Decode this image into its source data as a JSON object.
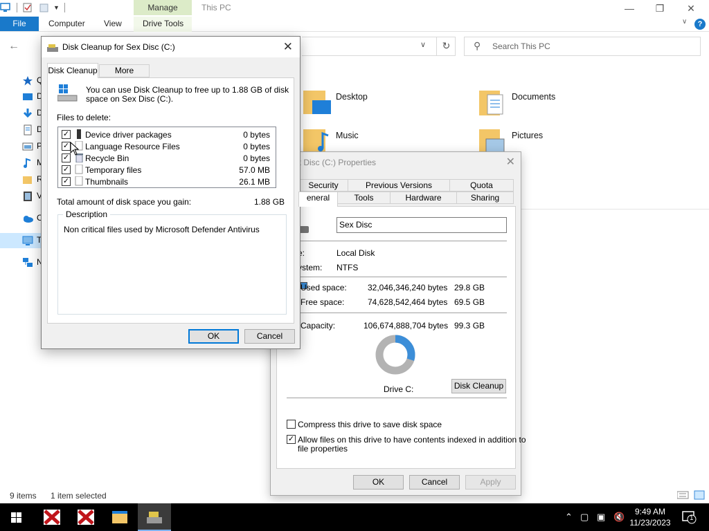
{
  "explorer": {
    "title": "This PC",
    "ribbon_context_tab": "Manage",
    "tabs": {
      "file": "File",
      "computer": "Computer",
      "view": "View",
      "drive_tools": "Drive Tools"
    },
    "search_placeholder": "Search This PC",
    "sidebar": [
      {
        "label": "Qu",
        "icon": "star-icon"
      },
      {
        "label": "D",
        "icon": "desktop-icon"
      },
      {
        "label": "D",
        "icon": "downloads-icon"
      },
      {
        "label": "D",
        "icon": "documents-icon"
      },
      {
        "label": "P",
        "icon": "pictures-icon"
      },
      {
        "label": "M",
        "icon": "music-icon"
      },
      {
        "label": "R",
        "icon": "folder-icon"
      },
      {
        "label": "V",
        "icon": "videos-icon"
      },
      {
        "label": "On",
        "icon": "onedrive-icon"
      },
      {
        "label": "Thi",
        "icon": "this-pc-icon"
      },
      {
        "label": "Ne",
        "icon": "network-icon"
      }
    ],
    "folders": [
      {
        "label": "Desktop"
      },
      {
        "label": "Documents"
      },
      {
        "label": "Music"
      },
      {
        "label": "Pictures"
      }
    ],
    "status": {
      "items": "9 items",
      "selected": "1 item selected"
    }
  },
  "properties": {
    "title": "x Disc (C:) Properties",
    "tabs_row1": [
      "Security",
      "Previous Versions",
      "Quota"
    ],
    "tabs_row2": [
      "eneral",
      "Tools",
      "Hardware",
      "Sharing"
    ],
    "name_value": "Sex Disc",
    "type_label": "e:",
    "type_value": "Local Disk",
    "fs_label": "ystem:",
    "fs_value": "NTFS",
    "used_label": "Used space:",
    "used_bytes": "32,046,346,240 bytes",
    "used_gb": "29.8 GB",
    "free_label": "Free space:",
    "free_bytes": "74,628,542,464 bytes",
    "free_gb": "69.5 GB",
    "capacity_label": "Capacity:",
    "capacity_bytes": "106,674,888,704 bytes",
    "capacity_gb": "99.3 GB",
    "used_fraction": 0.3,
    "used_color": "#3c8ed8",
    "free_color": "#b3b3b3",
    "drive_label": "Drive C:",
    "disk_cleanup_btn": "Disk Cleanup",
    "compress_label": "Compress this drive to save disk space",
    "compress_checked": false,
    "index_label_1": "Allow files on this drive to have contents indexed in addition to",
    "index_label_2": "file properties",
    "index_checked": true,
    "ok": "OK",
    "cancel": "Cancel",
    "apply": "Apply"
  },
  "disk_cleanup": {
    "title": "Disk Cleanup for Sex Disc  (C:)",
    "tab_active": "Disk Cleanup",
    "tab_other": "More Options",
    "intro_1": "You can use Disk Cleanup to free up to 1.88 GB of disk",
    "intro_2": "space on Sex Disc (C:).",
    "files_label": "Files to delete:",
    "files": [
      {
        "name": "Device driver packages",
        "size": "0 bytes",
        "checked": true
      },
      {
        "name": "Language Resource Files",
        "size": "0 bytes",
        "checked": true
      },
      {
        "name": "Recycle Bin",
        "size": "0 bytes",
        "checked": true
      },
      {
        "name": "Temporary files",
        "size": "57.0 MB",
        "checked": true
      },
      {
        "name": "Thumbnails",
        "size": "26.1 MB",
        "checked": true
      }
    ],
    "total_label": "Total amount of disk space you gain:",
    "total_value": "1.88 GB",
    "desc_label": "Description",
    "desc_text": "Non critical files used by Microsoft Defender Antivirus",
    "ok": "OK",
    "cancel": "Cancel"
  },
  "taskbar": {
    "time": "9:49 AM",
    "date": "11/23/2023",
    "notification_count": "1"
  }
}
